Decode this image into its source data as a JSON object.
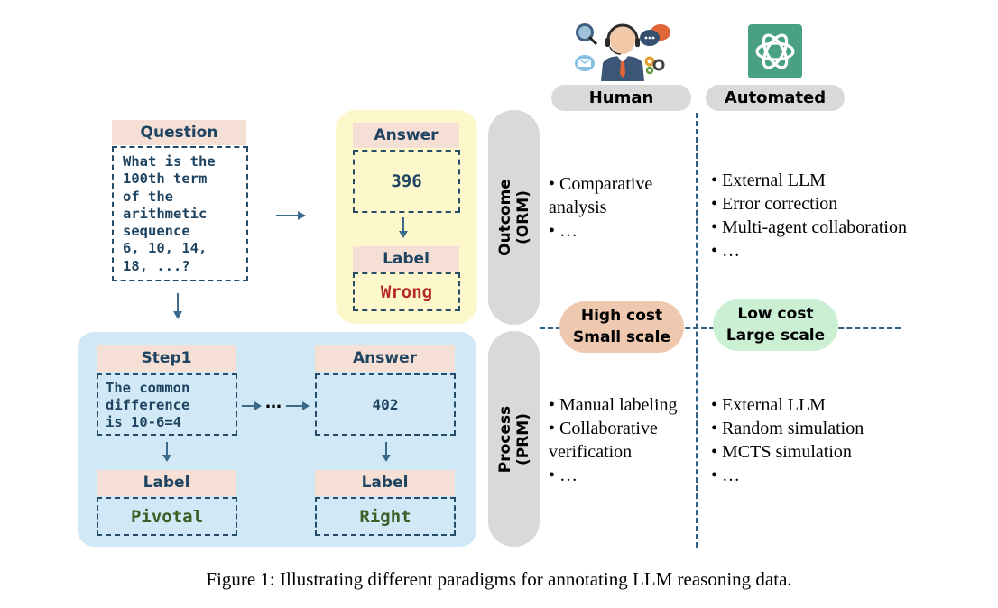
{
  "colors": {
    "dark_blue": "#1f4462",
    "wrong_red": "#b5282a",
    "right_green": "#3d5e26",
    "header_peach": "#f6e0d6",
    "yellow_panel": "#fdf8cc",
    "blue_panel": "#d1e9f6",
    "gray_pill": "#d9d9d9",
    "high_cost_pill": "#eec9b0",
    "low_cost_pill": "#cbefd2",
    "openai_green": "#4aa181"
  },
  "question": {
    "header": "Question",
    "text_lines": [
      "What is the",
      "100th term",
      "of the",
      "arithmetic",
      "sequence",
      "6, 10, 14,",
      "18, ...?"
    ]
  },
  "outcome_example": {
    "answer_header": "Answer",
    "answer_value": "396",
    "label_header": "Label",
    "label_value": "Wrong"
  },
  "process_example": {
    "step_header": "Step1",
    "step_lines": [
      "The common",
      "difference",
      "is 10-6=4"
    ],
    "ellipsis": "…",
    "answer_header": "Answer",
    "answer_value": "402",
    "step_label_header": "Label",
    "step_label_value": "Pivotal",
    "answer_label_header": "Label",
    "answer_label_value": "Right"
  },
  "columns": {
    "human": {
      "label": "Human",
      "icon": "customer-support-agent-icon"
    },
    "automated": {
      "label": "Automated",
      "icon": "openai-logo-icon"
    }
  },
  "rows": {
    "outcome": {
      "line1": "Outcome",
      "line2": "(ORM)"
    },
    "process": {
      "line1": "Process",
      "line2": "(PRM)"
    }
  },
  "cells": {
    "outcome_human": [
      "•  Comparative",
      "analysis",
      "• …"
    ],
    "outcome_automated": [
      "• External LLM",
      "• Error correction",
      "• Multi-agent collaboration",
      "• …"
    ],
    "process_human": [
      "• Manual labeling",
      "• Collaborative",
      "verification",
      "• …"
    ],
    "process_automated": [
      "• External LLM",
      "• Random simulation",
      "• MCTS simulation",
      "• …"
    ]
  },
  "cost_pills": {
    "human": {
      "line1": "High cost",
      "line2": "Small scale"
    },
    "automated": {
      "line1": "Low cost",
      "line2": "Large scale"
    }
  },
  "caption": "Figure 1: Illustrating different paradigms for annotating LLM reasoning data."
}
